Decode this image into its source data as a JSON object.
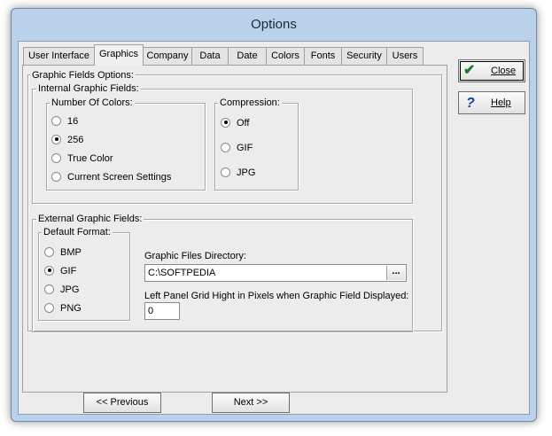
{
  "window": {
    "title": "Options"
  },
  "tabs": [
    {
      "label": "User Interface"
    },
    {
      "label": "Graphics"
    },
    {
      "label": "Company"
    },
    {
      "label": "Data"
    },
    {
      "label": "Date"
    },
    {
      "label": "Colors"
    },
    {
      "label": "Fonts"
    },
    {
      "label": "Security"
    },
    {
      "label": "Users"
    }
  ],
  "active_tab": "Graphics",
  "graphic_fields": {
    "legend": "Graphic Fields Options:",
    "internal": {
      "legend": "Internal Graphic Fields:",
      "colors": {
        "legend": "Number Of Colors:",
        "options": [
          "16",
          "256",
          "True Color",
          "Current Screen Settings"
        ],
        "selected": "256"
      },
      "compression": {
        "legend": "Compression:",
        "options": [
          "Off",
          "GIF",
          "JPG"
        ],
        "selected": "Off"
      }
    },
    "external": {
      "legend": "External Graphic Fields:",
      "format": {
        "legend": "Default Format:",
        "options": [
          "BMP",
          "GIF",
          "JPG",
          "PNG"
        ],
        "selected": "GIF"
      },
      "directory_label": "Graphic Files Directory:",
      "directory_value": "C:\\SOFTPEDIA",
      "browse_label": "...",
      "grid_label": "Left Panel Grid Hight in Pixels when Graphic Field Displayed:",
      "grid_value": "0"
    }
  },
  "buttons": {
    "close": {
      "label": "Close",
      "icon": "checkmark-icon",
      "icon_color": "#1f7a1f"
    },
    "help": {
      "label": "Help",
      "icon": "question-icon",
      "icon_color": "#1a3fa8"
    },
    "previous": "<< Previous",
    "next": "Next >>"
  }
}
